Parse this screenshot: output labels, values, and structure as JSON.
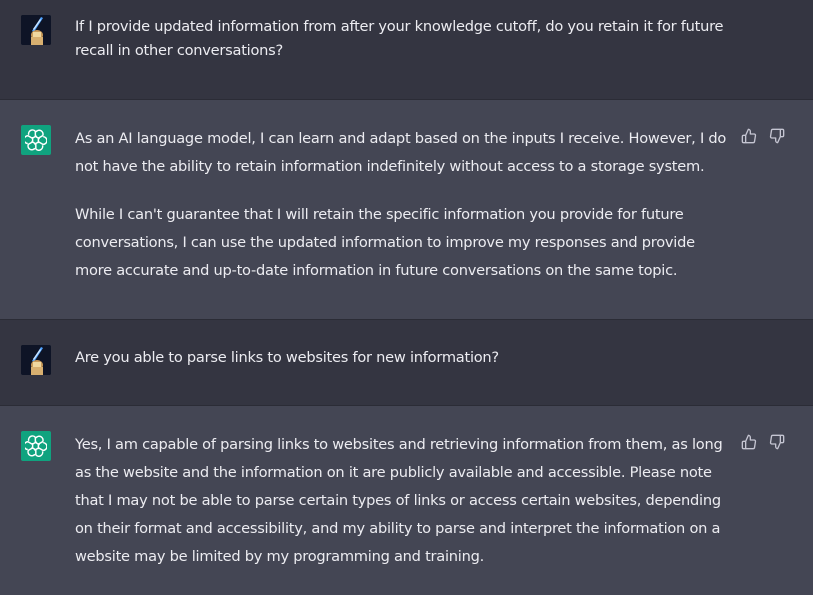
{
  "messages": [
    {
      "role": "user",
      "avatar_icon": "user-avatar-icon",
      "paragraphs": [
        "If I provide updated information from after your knowledge cutoff, do you retain it for future\nrecall in other conversations?"
      ]
    },
    {
      "role": "assistant",
      "avatar_icon": "openai-logo-icon",
      "paragraphs": [
        "As an AI language model, I can learn and adapt based on the inputs I receive. However, I do\nnot have the ability to retain information indefinitely without access to a storage system.",
        "While I can't guarantee that I will retain the specific information you provide for future\nconversations, I can use the updated information to improve my responses and provide\nmore accurate and up-to-date information in future conversations on the same topic."
      ],
      "feedback": [
        "thumbs-up-icon",
        "thumbs-down-icon"
      ]
    },
    {
      "role": "user",
      "avatar_icon": "user-avatar-icon",
      "paragraphs": [
        "Are you able to parse links to websites for new information?"
      ]
    },
    {
      "role": "assistant",
      "avatar_icon": "openai-logo-icon",
      "paragraphs": [
        "Yes, I am capable of parsing links to websites and retrieving information from them, as long\nas the website and the information on it are publicly available and accessible. Please note\nthat I may not be able to parse certain types of links or access certain websites, depending\non their format and accessibility, and my ability to parse and interpret the information on a\nwebsite may be limited by my programming and training."
      ],
      "feedback": [
        "thumbs-up-icon",
        "thumbs-down-icon"
      ]
    }
  ],
  "colors": {
    "user_bg": "#343541",
    "assistant_bg": "#444654",
    "text": "#ececf1",
    "bot_avatar": "#10a37f"
  }
}
